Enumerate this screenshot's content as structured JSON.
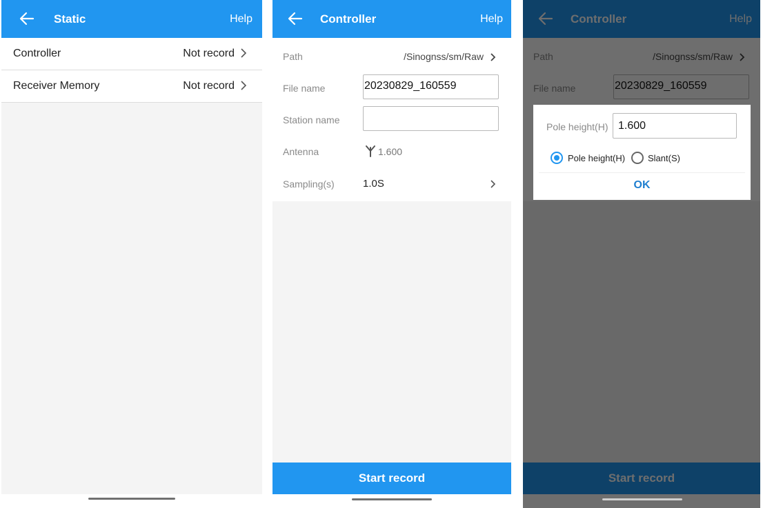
{
  "screens": [
    {
      "appbar": {
        "title": "Static",
        "help": "Help",
        "back_icon": "arrow-left-icon"
      },
      "rows": [
        {
          "label": "Controller",
          "value": "Not record"
        },
        {
          "label": "Receiver Memory",
          "value": "Not record"
        }
      ]
    },
    {
      "appbar": {
        "title": "Controller",
        "help": "Help",
        "back_icon": "arrow-left-icon"
      },
      "path": {
        "label": "Path",
        "value": "/Sinognss/sm/Raw"
      },
      "file_name": {
        "label": "File name",
        "value": "20230829_160559"
      },
      "station_name": {
        "label": "Station name",
        "value": ""
      },
      "antenna": {
        "label": "Antenna",
        "value": "1.600",
        "icon": "antenna-icon"
      },
      "sampling": {
        "label": "Sampling(s)",
        "value": "1.0S"
      },
      "start_button": "Start record"
    },
    {
      "appbar": {
        "title": "Controller",
        "help": "Help",
        "back_icon": "arrow-left-icon"
      },
      "path": {
        "label": "Path",
        "value": "/Sinognss/sm/Raw"
      },
      "file_name": {
        "label": "File name",
        "value": "20230829_160559"
      },
      "start_button": "Start record",
      "dialog": {
        "pole_label": "Pole height(H)",
        "pole_value": "1.600",
        "options": [
          {
            "label": "Pole height(H)",
            "selected": true
          },
          {
            "label": "Slant(S)",
            "selected": false
          }
        ],
        "ok": "OK"
      }
    }
  ],
  "colors": {
    "primary": "#2196f0",
    "ok_text": "#1f7fd0",
    "background": "#f4f4f4"
  }
}
